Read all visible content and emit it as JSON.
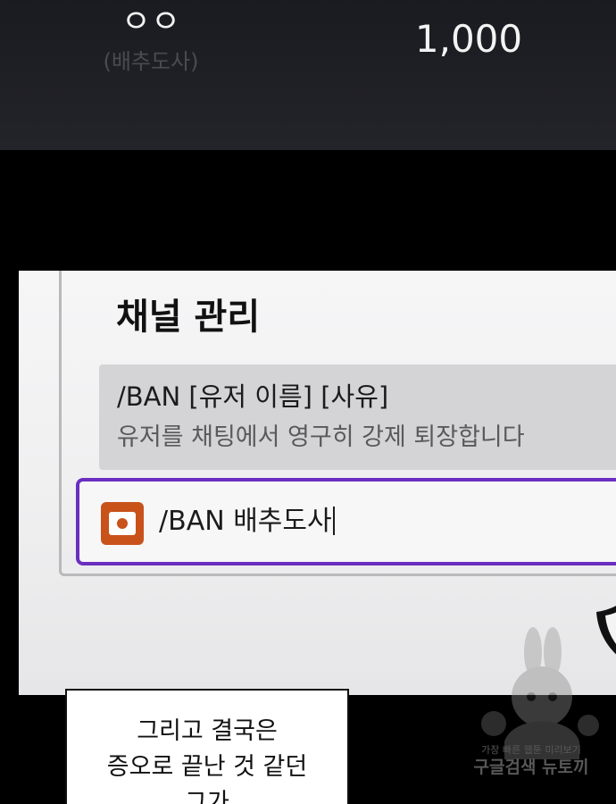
{
  "top_panel": {
    "name": "ㅇㅇ",
    "sub_name": "(배추도사)",
    "amount": "1,000"
  },
  "channel_panel": {
    "title": "채널 관리",
    "command": {
      "syntax": "/BAN [유저 이름] [사유]",
      "description": "유저를 채팅에서 영구히 강제 퇴장합니다"
    },
    "input": {
      "value": "/BAN 배추도사",
      "icon": "stream-icon",
      "accent_color": "#6a2fc0"
    },
    "side_icon": "shield-icon"
  },
  "speech_bubble": {
    "lines": [
      "그리고 결국은",
      "증오로 끝난 것 같던",
      "그가"
    ]
  },
  "watermark": {
    "line1": "가장 빠른 웹툰 미리보기",
    "line2": "구글검색 뉴토끼"
  },
  "colors": {
    "background": "#000000",
    "top_panel": "#1f2025",
    "icon_orange": "#c9521b"
  }
}
